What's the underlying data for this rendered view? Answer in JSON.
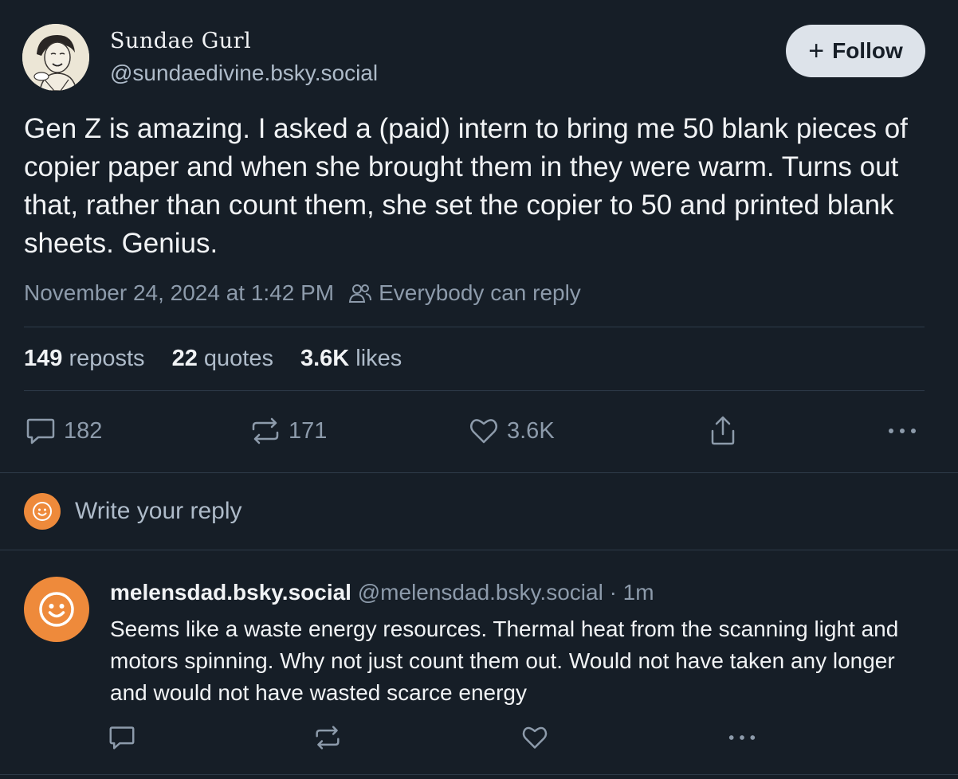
{
  "post": {
    "author_name": "Sundae Gurl",
    "author_handle": "@sundaedivine.bsky.social",
    "follow_label": "Follow",
    "text": "Gen Z is amazing. I asked a (paid) intern to bring me 50 blank pieces of copier paper and when she brought them in they were warm. Turns out that, rather than count them, she set the copier to 50 and printed blank sheets. Genius.",
    "timestamp": "November 24, 2024 at 1:42 PM",
    "reply_setting": "Everybody can reply",
    "stats": {
      "reposts_count": "149",
      "reposts_label": "reposts",
      "quotes_count": "22",
      "quotes_label": "quotes",
      "likes_count": "3.6K",
      "likes_label": "likes"
    },
    "actions": {
      "reply_count": "182",
      "repost_count": "171",
      "like_count": "3.6K"
    },
    "icons": [
      "comment-icon",
      "repost-icon",
      "heart-icon",
      "share-icon",
      "more-icon",
      "people-icon",
      "plus-icon"
    ]
  },
  "composer": {
    "placeholder": "Write your reply"
  },
  "reply": {
    "display_name": "melensdad.bsky.social",
    "handle_time": "@melensdad.bsky.social · 1m",
    "text": "Seems like a waste energy resources.  Thermal heat from the scanning light and motors spinning. Why not just count them out.  Would not have taken any longer and would not have wasted scarce energy"
  },
  "colors": {
    "background": "#161e27",
    "accent_avatar": "#ee8a3b",
    "follow_button": "#dde3ea"
  }
}
